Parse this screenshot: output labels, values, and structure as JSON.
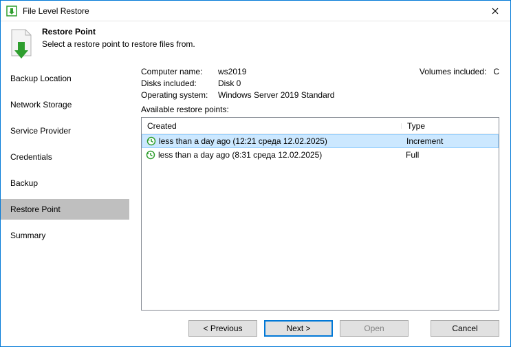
{
  "window": {
    "title": "File Level Restore"
  },
  "header": {
    "heading": "Restore Point",
    "sub": "Select a restore point to restore files from."
  },
  "sidebar": {
    "items": [
      {
        "label": "Backup Location"
      },
      {
        "label": "Network Storage"
      },
      {
        "label": "Service Provider"
      },
      {
        "label": "Credentials"
      },
      {
        "label": "Backup"
      },
      {
        "label": "Restore Point"
      },
      {
        "label": "Summary"
      }
    ],
    "selected_index": 5
  },
  "info": {
    "computer_name_label": "Computer name:",
    "computer_name": "ws2019",
    "disks_included_label": "Disks included:",
    "disks_included": "Disk 0",
    "os_label": "Operating system:",
    "os": "Windows Server 2019 Standard",
    "volumes_label": "Volumes included:",
    "volumes": "C",
    "available_label": "Available restore points:"
  },
  "table": {
    "headers": {
      "created": "Created",
      "type": "Type"
    },
    "rows": [
      {
        "created": "less than a day ago (12:21 среда 12.02.2025)",
        "type": "Increment",
        "selected": true
      },
      {
        "created": "less than a day ago (8:31 среда 12.02.2025)",
        "type": "Full",
        "selected": false
      }
    ]
  },
  "buttons": {
    "previous": "< Previous",
    "next": "Next >",
    "open": "Open",
    "cancel": "Cancel"
  }
}
